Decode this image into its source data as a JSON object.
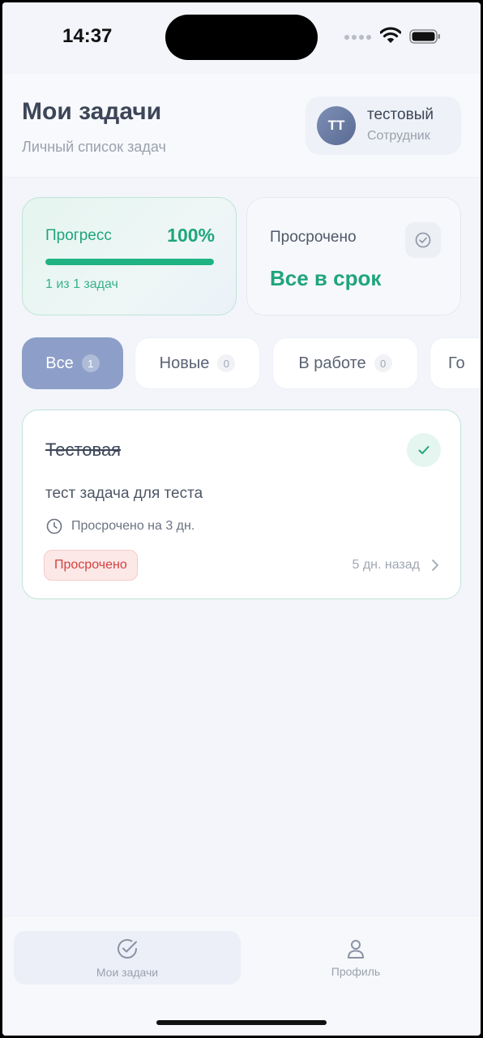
{
  "status_bar": {
    "time": "14:37"
  },
  "header": {
    "title": "Мои задачи",
    "subtitle": "Личный список задач",
    "user": {
      "initials": "ТТ",
      "name": "тестовый",
      "role": "Сотрудник"
    }
  },
  "stats": {
    "progress": {
      "label": "Прогресс",
      "value": "100%",
      "fraction": 1.0,
      "count_text": "1 из 1 задач"
    },
    "overdue": {
      "label": "Просрочено",
      "value": "Все в срок",
      "icon": "check-circle-icon"
    }
  },
  "tabs": [
    {
      "label": "Все",
      "count": "1",
      "active": true
    },
    {
      "label": "Новые",
      "count": "0",
      "active": false
    },
    {
      "label": "В работе",
      "count": "0",
      "active": false
    },
    {
      "label": "Го",
      "count": "",
      "active": false
    }
  ],
  "tasks": [
    {
      "title": "Тестовая",
      "description": "тест задача для теста",
      "due_text": "Просрочено на 3 дн.",
      "status_badge": "Просрочено",
      "created_ago": "5 дн. назад",
      "completed": true
    }
  ],
  "bottom_nav": {
    "tasks_label": "Мои задачи",
    "profile_label": "Профиль"
  },
  "colors": {
    "accent_green": "#1fa57a",
    "tab_active": "#8d9fc8",
    "badge_red": "#d2423d"
  }
}
